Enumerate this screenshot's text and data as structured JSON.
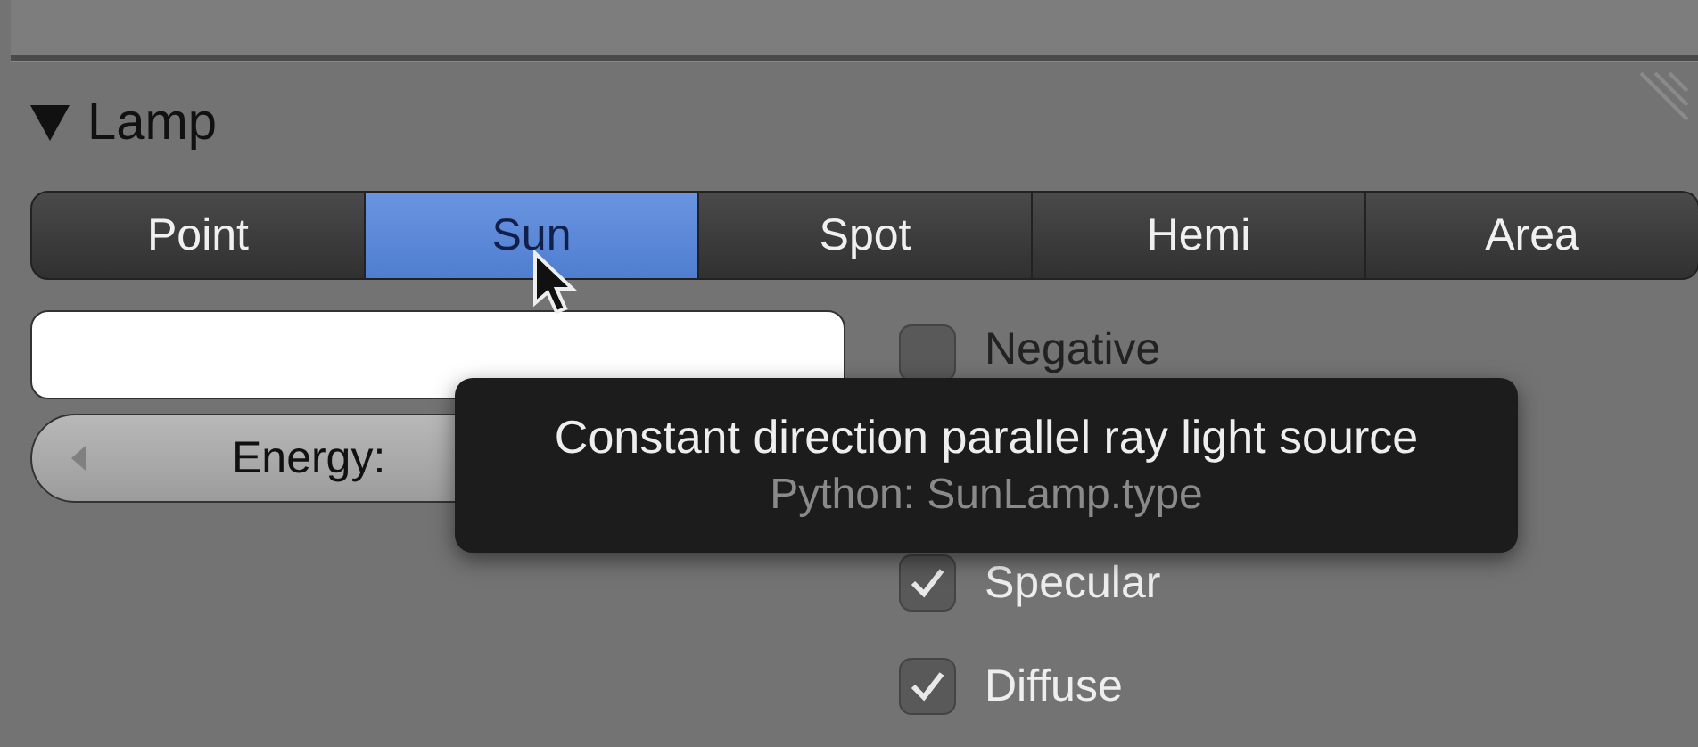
{
  "panel": {
    "title": "Lamp",
    "expanded": true
  },
  "lamp_types": [
    {
      "label": "Point",
      "selected": false
    },
    {
      "label": "Sun",
      "selected": true
    },
    {
      "label": "Spot",
      "selected": false
    },
    {
      "label": "Hemi",
      "selected": false
    },
    {
      "label": "Area",
      "selected": false
    }
  ],
  "energy": {
    "label": "Energy:"
  },
  "options": [
    {
      "label": "Negative",
      "checked": false,
      "kind": "checkbox"
    },
    {
      "kind": "hidden"
    },
    {
      "label": "Specular",
      "checked": true,
      "kind": "checkbox"
    },
    {
      "label": "Diffuse",
      "checked": true,
      "kind": "checkbox"
    }
  ],
  "tooltip": {
    "text": "Constant direction parallel ray light source",
    "python": "Python: SunLamp.type"
  }
}
